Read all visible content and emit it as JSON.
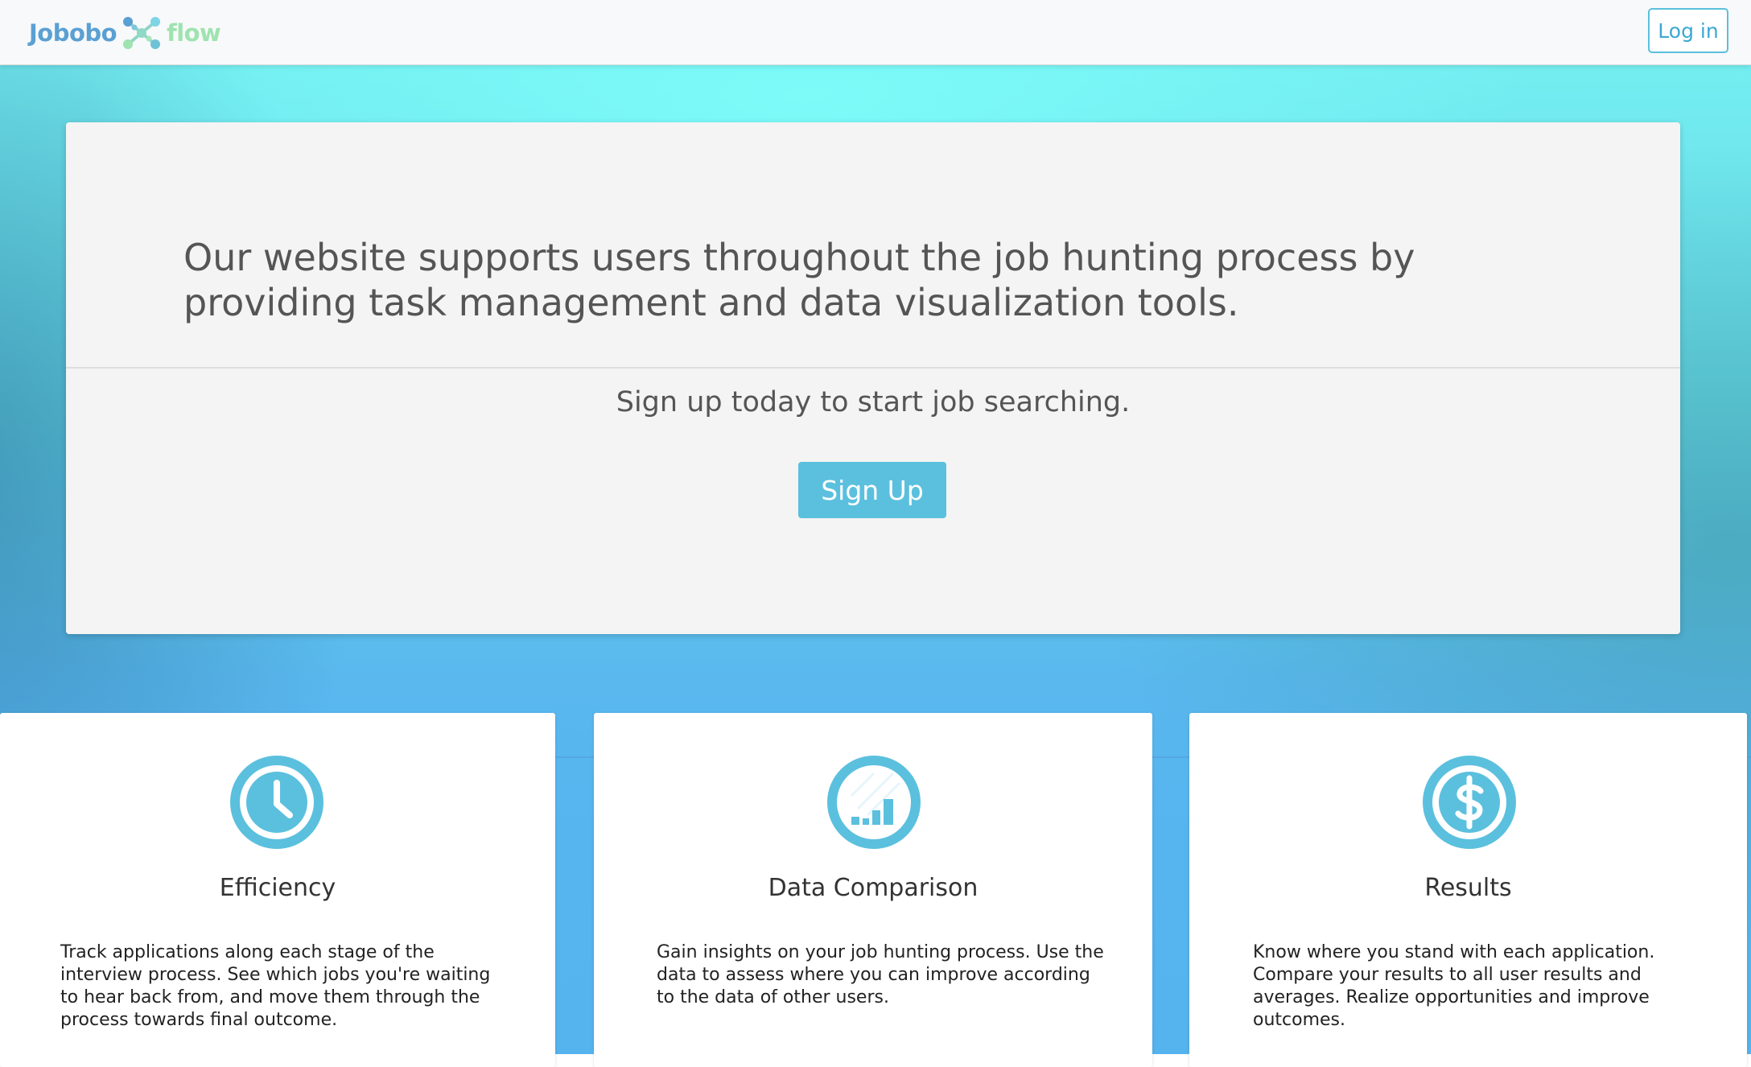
{
  "header": {
    "brand_left": "Jobobo",
    "brand_right": "flow",
    "login_label": "Log in"
  },
  "hero": {
    "lead": "Our website supports users throughout the job hunting process by providing task management and data visualization tools.",
    "cta_text": "Sign up today to start job searching.",
    "signup_label": "Sign Up"
  },
  "features": [
    {
      "icon": "clock-icon",
      "title": "Efficiency",
      "description": "Track applications along each stage of the interview process. See which jobs you're waiting to hear back from, and move them through the process towards final outcome."
    },
    {
      "icon": "bar-chart-icon",
      "title": "Data Comparison",
      "description": "Gain insights on your job hunting process. Use the data to assess where you can improve according to the data of other users."
    },
    {
      "icon": "dollar-icon",
      "title": "Results",
      "description": "Know where you stand with each application. Compare your results to all user results and averages. Realize opportunities and improve outcomes."
    }
  ],
  "colors": {
    "accent": "#5bc0de",
    "brand_blue": "#5aa0d3",
    "brand_green": "#9ee3b0"
  }
}
